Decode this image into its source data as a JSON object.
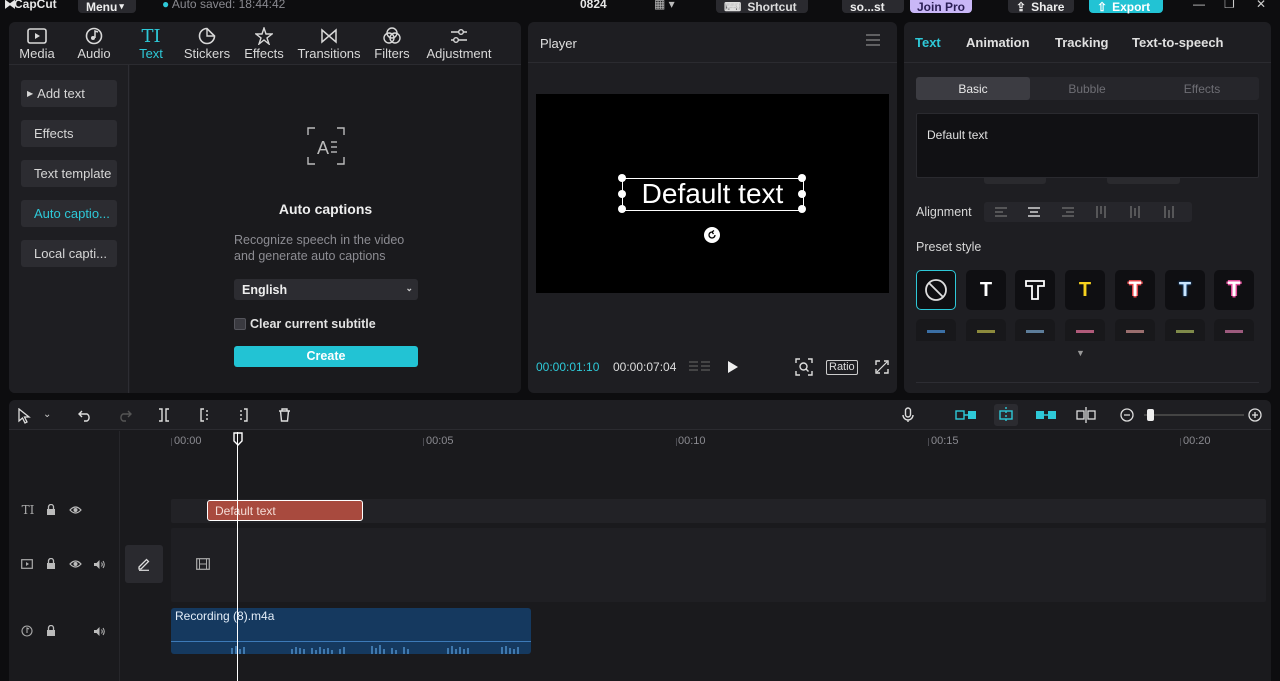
{
  "app": {
    "logo_text": "CapCut",
    "menu_label": "Menu",
    "autosave_text": "Auto saved: 18:44:42",
    "project_name": "0824",
    "shortcut_label": "Shortcut",
    "user_name": "so...st",
    "join_pro_label": "Join Pro",
    "share_label": "Share",
    "export_label": "Export"
  },
  "tool_tabs": [
    {
      "label": "Media",
      "icon": "media-icon"
    },
    {
      "label": "Audio",
      "icon": "audio-icon"
    },
    {
      "label": "Text",
      "icon": "text-icon"
    },
    {
      "label": "Stickers",
      "icon": "stickers-icon"
    },
    {
      "label": "Effects",
      "icon": "effects-icon"
    },
    {
      "label": "Transitions",
      "icon": "transitions-icon"
    },
    {
      "label": "Filters",
      "icon": "filters-icon"
    },
    {
      "label": "Adjustment",
      "icon": "adjustment-icon"
    }
  ],
  "left_nav": [
    {
      "label": "Add text"
    },
    {
      "label": "Effects"
    },
    {
      "label": "Text template"
    },
    {
      "label": "Auto captio..."
    },
    {
      "label": "Local capti..."
    }
  ],
  "auto_captions": {
    "title": "Auto captions",
    "description": "Recognize speech in the video and generate auto captions",
    "language": "English",
    "clear_subtitle_label": "Clear current subtitle",
    "create_label": "Create"
  },
  "player": {
    "title": "Player",
    "overlay_text": "Default text",
    "current_time": "00:00:01:10",
    "total_time": "00:00:07:04",
    "ratio_label": "Ratio"
  },
  "inspector": {
    "tabs": [
      "Text",
      "Animation",
      "Tracking",
      "Text-to-speech"
    ],
    "subtabs": [
      "Basic",
      "Bubble",
      "Effects"
    ],
    "text_value": "Default text",
    "alignment_label": "Alignment",
    "preset_label": "Preset style"
  },
  "timeline": {
    "ruler": [
      "00:00",
      "00:05",
      "00:10",
      "00:15",
      "00:20"
    ],
    "text_clip_label": "Default text",
    "audio_clip_label": "Recording (8).m4a"
  },
  "colors": {
    "accent": "#2ec9d8",
    "text_clip": "#a84a3e",
    "audio_clip": "#15395f"
  }
}
